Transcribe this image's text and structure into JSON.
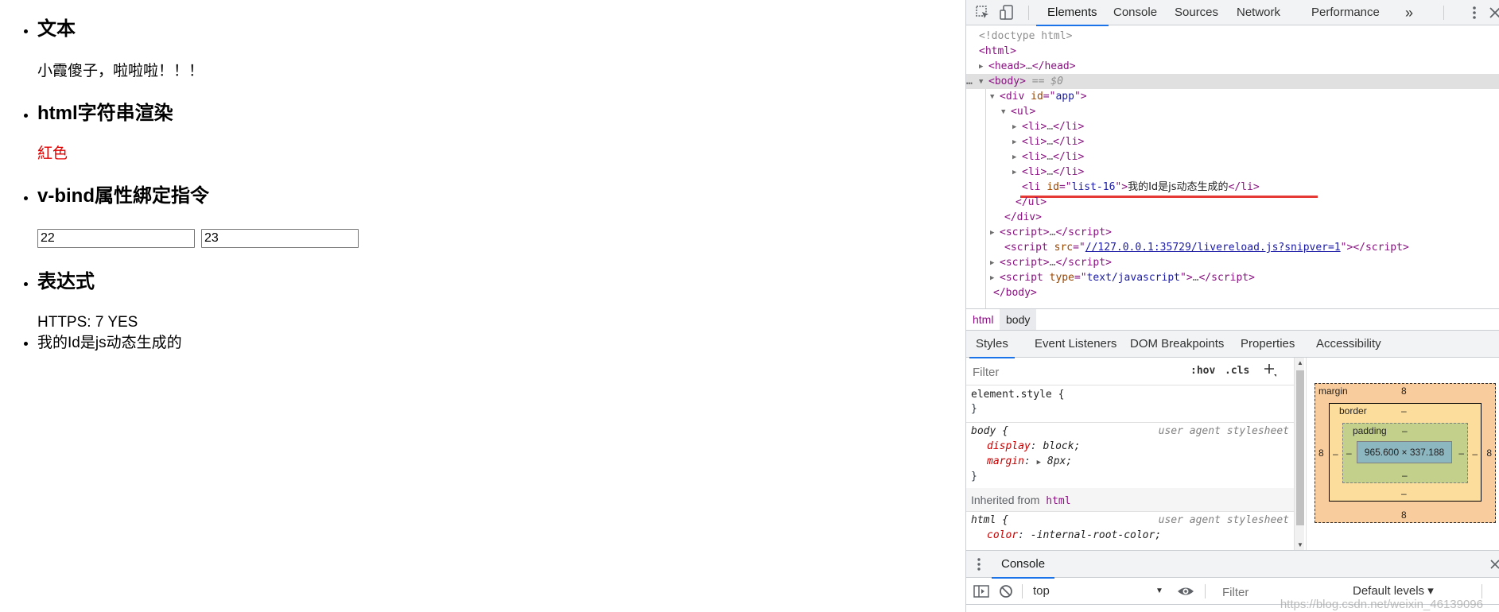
{
  "page": {
    "sections": [
      {
        "title": "文本",
        "text": "小霞傻子，啦啦啦！！！"
      },
      {
        "title": "html字符串渲染",
        "text": "紅色"
      },
      {
        "title": "v-bind属性綁定指令",
        "inputs": [
          "22",
          "23"
        ]
      },
      {
        "title": "表达式",
        "text": "HTTPS: 7 YES"
      }
    ],
    "dynamic_item": "我的Id是js动态生成的"
  },
  "devtools": {
    "tabs": [
      "Elements",
      "Console",
      "Sources",
      "Network",
      "Performance"
    ],
    "more": "»",
    "dom": {
      "doctype": "<!doctype html>",
      "body_suffix": "== $0",
      "div_id": "app",
      "li_id": "list-16",
      "li_text": "我的Id是js动态生成的",
      "script_src": "//127.0.0.1:35729/livereload.js?snipver=1",
      "script_type": "text/javascript"
    },
    "breadcrumbs": [
      "html",
      "body"
    ],
    "subtabs": [
      "Styles",
      "Event Listeners",
      "DOM Breakpoints",
      "Properties",
      "Accessibility"
    ],
    "styles": {
      "filter_placeholder": "Filter",
      "hov": ":hov",
      "cls": ".cls",
      "element_style": "element.style {",
      "close_brace": "}",
      "body_selector": "body {",
      "source": "user agent stylesheet",
      "display_prop": "display",
      "display_val": "block;",
      "margin_prop": "margin",
      "margin_val": "8px;",
      "inherited_label": "Inherited from",
      "inherited_tag": "html",
      "html_selector": "html {",
      "color_prop": "color",
      "color_val": "-internal-root-color;"
    },
    "boxmodel": {
      "margin_label": "margin",
      "margin": "8",
      "margin_left": "8",
      "margin_right": "8",
      "margin_bottom": "8",
      "border_label": "border",
      "border": "–",
      "border_bottom": "–",
      "border_left": "–",
      "border_right": "–",
      "padding_label": "padding",
      "padding": "–",
      "padding_bottom": "–",
      "padding_left": "–",
      "padding_right": "–",
      "content": "965.600 × 337.188"
    },
    "console": {
      "tab": "Console",
      "context": "top",
      "filter_placeholder": "Filter",
      "levels": "Default levels ▾",
      "watermark": "https://blog.csdn.net/weixin_46139096"
    },
    "colors": {
      "accent": "#1a73e8",
      "tag": "#881280",
      "attr_name": "#994500",
      "attr_value": "#1a1aa6",
      "annotation": "#e53935"
    }
  }
}
